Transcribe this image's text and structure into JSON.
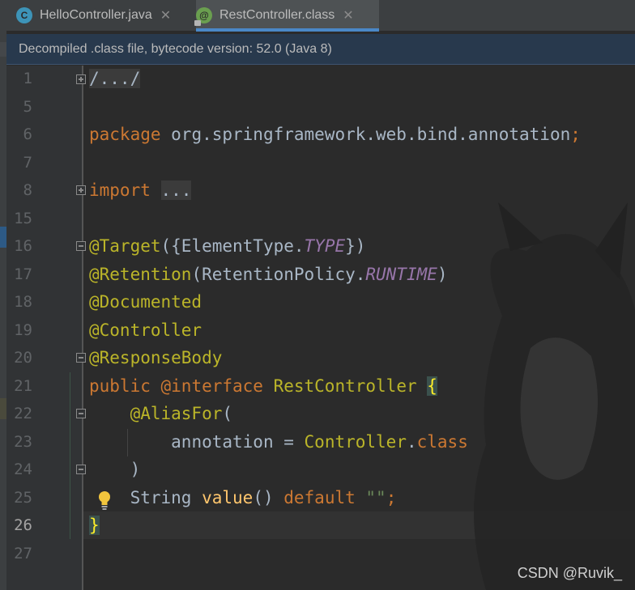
{
  "tabs": [
    {
      "label": "HelloController.java",
      "icon": "class-c-icon",
      "icon_letter": "C",
      "close": "✕",
      "active": false
    },
    {
      "label": "RestController.class",
      "icon": "annotation-icon",
      "icon_letter": "@",
      "close": "✕",
      "active": true
    }
  ],
  "banner": {
    "text": "Decompiled .class file, bytecode version: 52.0 (Java 8)"
  },
  "editor": {
    "current_line": "26",
    "line_numbers": [
      "1",
      "5",
      "6",
      "7",
      "8",
      "15",
      "16",
      "17",
      "18",
      "19",
      "20",
      "21",
      "22",
      "23",
      "24",
      "25",
      "26",
      "27"
    ],
    "code": {
      "l1_folded": "/.../",
      "l6_kw": "package",
      "l6_pkg": " org.springframework.web.bind.annotation",
      "l6_semi": ";",
      "l8_kw": "import",
      "l8_folded": "...",
      "l16_ann": "@Target",
      "l16_open": "({ElementType.",
      "l16_const": "TYPE",
      "l16_close": "})",
      "l17_ann": "@Retention",
      "l17_open": "(RetentionPolicy.",
      "l17_const": "RUNTIME",
      "l17_close": ")",
      "l18_ann": "@Documented",
      "l19_ann": "@Controller",
      "l20_ann": "@ResponseBody",
      "l21_kw": "public ",
      "l21_ann": "@interface",
      "l21_name": " RestController ",
      "l21_brace": "{",
      "l22_ann": "@AliasFor",
      "l22_paren": "(",
      "l23_attr": "annotation = ",
      "l23_cls": "Controller",
      "l23_dot": ".",
      "l23_kw": "class",
      "l24_paren": ")",
      "l25_type": "String ",
      "l25_method": "value",
      "l25_parens": "() ",
      "l25_kw": "default ",
      "l25_str": "\"\"",
      "l25_semi": ";",
      "l26_brace": "}"
    }
  },
  "watermark": "CSDN @Ruvik_",
  "colors": {
    "keyword": "#cc7832",
    "annotation": "#bbb529",
    "constant": "#9876aa",
    "string": "#6a8759",
    "text": "#a9b7c6"
  }
}
